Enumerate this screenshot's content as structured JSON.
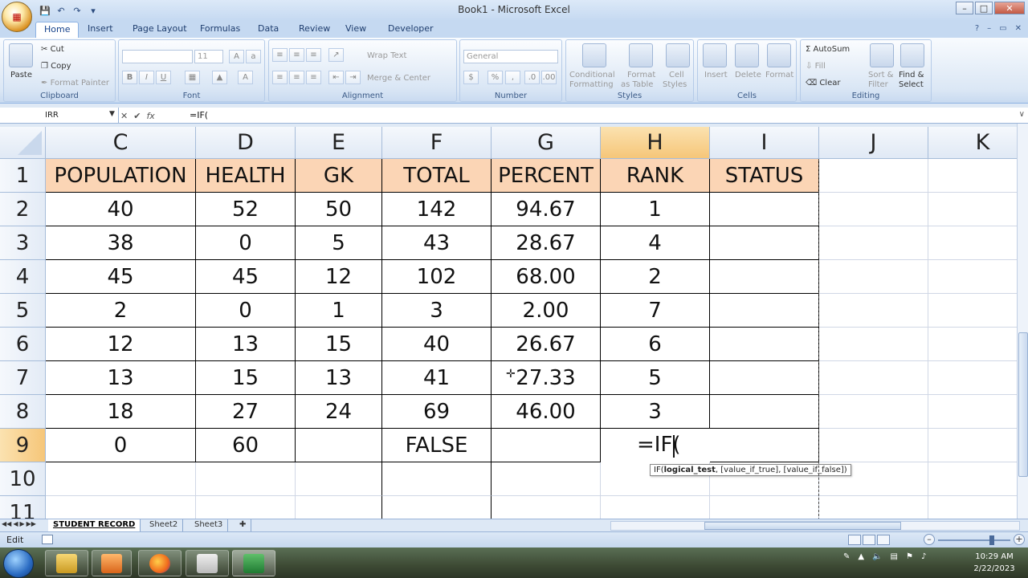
{
  "window": {
    "title": "Book1 - Microsoft Excel",
    "controls": [
      "–",
      "□",
      "✕"
    ]
  },
  "tabs": [
    "Home",
    "Insert",
    "Page Layout",
    "Formulas",
    "Data",
    "Review",
    "View",
    "Developer"
  ],
  "ribbon": {
    "clipboard": {
      "paste": "Paste",
      "cut": "Cut",
      "copy": "Copy",
      "format_painter": "Format Painter",
      "label": "Clipboard"
    },
    "font": {
      "font_name": "",
      "font_size": "11",
      "bold": "B",
      "italic": "I",
      "underline": "U",
      "label": "Font"
    },
    "alignment": {
      "wrap_text": "Wrap Text",
      "merge_center": "Merge & Center",
      "label": "Alignment"
    },
    "number": {
      "format": "General",
      "currency": "$",
      "percent": "%",
      "label": "Number"
    },
    "styles": {
      "conditional_1": "Conditional",
      "conditional_2": "Formatting",
      "format_table_1": "Format",
      "format_table_2": "as Table",
      "cell_styles_1": "Cell",
      "cell_styles_2": "Styles",
      "label": "Styles"
    },
    "cells": {
      "insert": "Insert",
      "delete": "Delete",
      "format": "Format",
      "label": "Cells"
    },
    "editing": {
      "autosum": "AutoSum",
      "fill": "Fill",
      "clear": "Clear",
      "sort_1": "Sort &",
      "sort_2": "Filter",
      "find_1": "Find &",
      "find_2": "Select",
      "label": "Editing"
    }
  },
  "formula_bar": {
    "name_box": "IRR",
    "icons": [
      "✕",
      "✔",
      "fx"
    ],
    "formula": "=IF("
  },
  "grid": {
    "columns": [
      "C",
      "D",
      "E",
      "F",
      "G",
      "H",
      "I",
      "J",
      "K"
    ],
    "rows": [
      "1",
      "2",
      "3",
      "4",
      "5",
      "6",
      "7",
      "8",
      "9",
      "10",
      "11"
    ],
    "header": [
      "POPULATION",
      "HEALTH",
      "GK",
      "TOTAL",
      "PERCENT",
      "RANK",
      "STATUS"
    ],
    "data": [
      [
        "40",
        "52",
        "50",
        "142",
        "94.67",
        "1",
        ""
      ],
      [
        "38",
        "0",
        "5",
        "43",
        "28.67",
        "4",
        ""
      ],
      [
        "45",
        "45",
        "12",
        "102",
        "68.00",
        "2",
        ""
      ],
      [
        "2",
        "0",
        "1",
        "3",
        "2.00",
        "7",
        ""
      ],
      [
        "12",
        "13",
        "15",
        "40",
        "26.67",
        "6",
        ""
      ],
      [
        "13",
        "15",
        "13",
        "41",
        "27.33",
        "5",
        ""
      ],
      [
        "18",
        "27",
        "24",
        "69",
        "46.00",
        "3",
        ""
      ]
    ],
    "row9": {
      "C": "0",
      "D": "60",
      "F": "FALSE"
    },
    "editing_cell": "=IF(",
    "tooltip": {
      "fn": "IF(",
      "arg1": "logical_test",
      "rest": ", [value_if_true], [value_if_false])"
    }
  },
  "sheets": [
    "STUDENT RECORD",
    "Sheet2",
    "Sheet3"
  ],
  "status": {
    "mode": "Edit"
  },
  "clock": {
    "time": "10:29 AM",
    "date": "2/22/2023"
  },
  "colors": {
    "header_fill": "#fbd5b5",
    "selected_header": "#f6c679",
    "ribbon_blue": "#c5d9f1"
  }
}
